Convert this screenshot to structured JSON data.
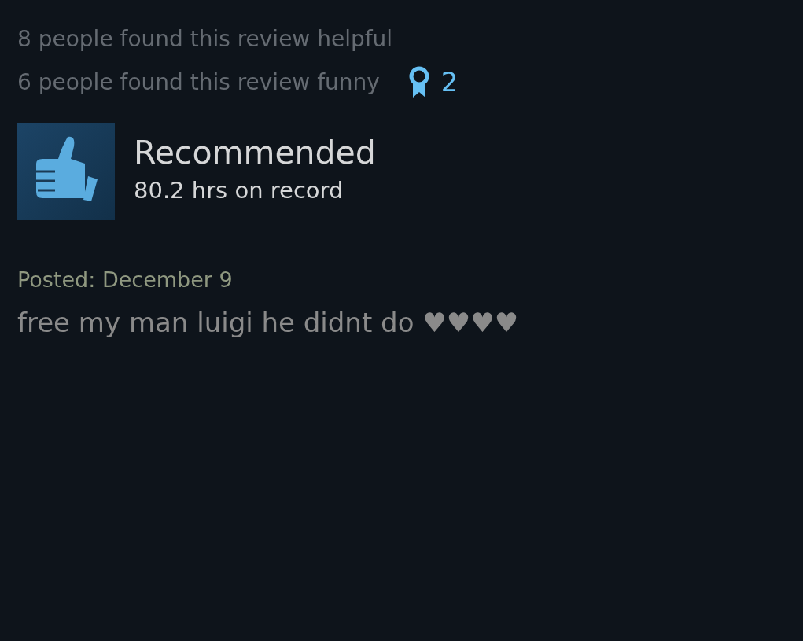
{
  "helpful": "8 people found this review helpful",
  "funny": "6 people found this review funny",
  "awards": "2",
  "verdict": {
    "title": "Recommended",
    "recommended": true,
    "hours": "80.2 hrs on record"
  },
  "posted": "Posted: December 9",
  "review": "free my man luigi he didnt do ♥♥♥♥"
}
